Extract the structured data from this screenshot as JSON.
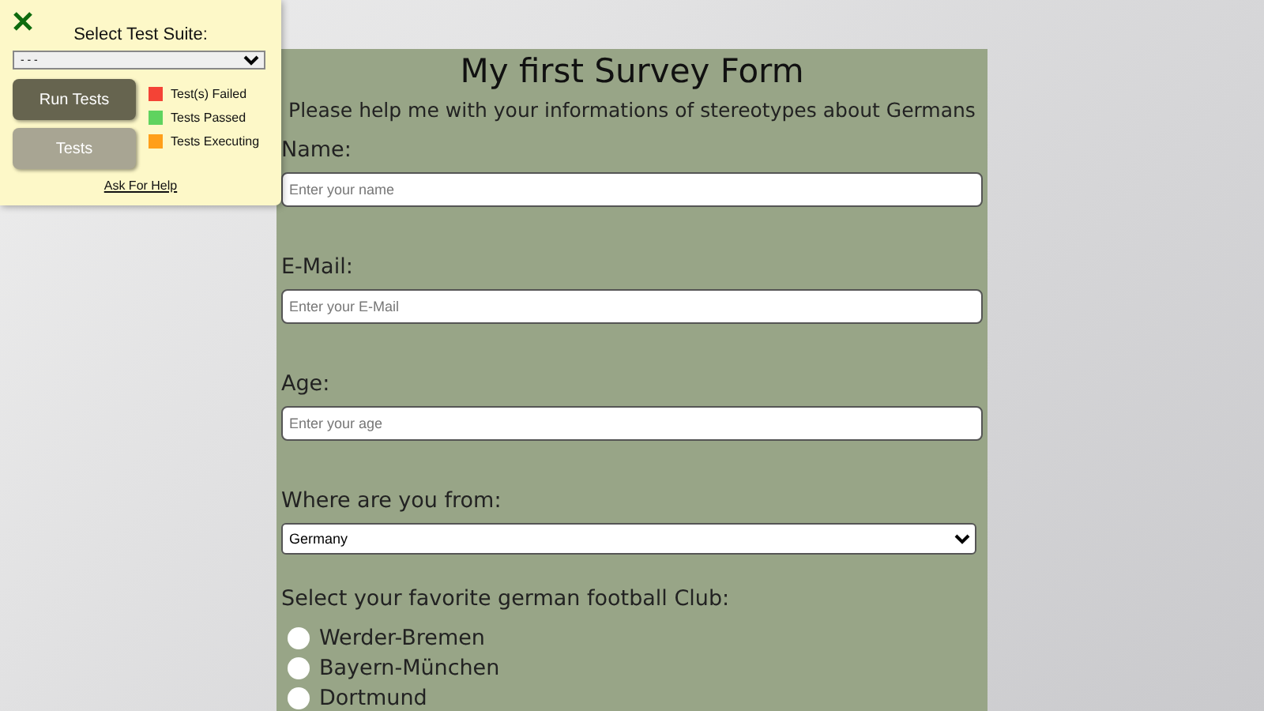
{
  "test_panel": {
    "title": "Select Test Suite:",
    "suite_select": {
      "value": "- - -"
    },
    "buttons": [
      {
        "label": "Run Tests",
        "kind": "primary"
      },
      {
        "label": "Tests",
        "kind": "secondary"
      }
    ],
    "legend": [
      {
        "label": "Test(s) Failed",
        "color": "#f44336"
      },
      {
        "label": "Tests Passed",
        "color": "#5fd35f"
      },
      {
        "label": "Tests Executing",
        "color": "#ff9f1a"
      }
    ],
    "help_link": "Ask For Help"
  },
  "form": {
    "title": "My first Survey Form",
    "description": "Please help me with your informations of stereotypes about Germans",
    "fields": [
      {
        "label": "Name:",
        "placeholder": "Enter your name"
      },
      {
        "label": "E-Mail:",
        "placeholder": "Enter your E-Mail"
      },
      {
        "label": "Age:",
        "placeholder": "Enter your age"
      }
    ],
    "origin": {
      "label": "Where are you from:",
      "value": "Germany"
    },
    "club": {
      "label": "Select your favorite german football Club:",
      "options": [
        {
          "label": "Werder-Bremen",
          "selected": false
        },
        {
          "label": "Bayern-München",
          "selected": false
        },
        {
          "label": "Dortmund",
          "selected": false
        }
      ]
    }
  }
}
